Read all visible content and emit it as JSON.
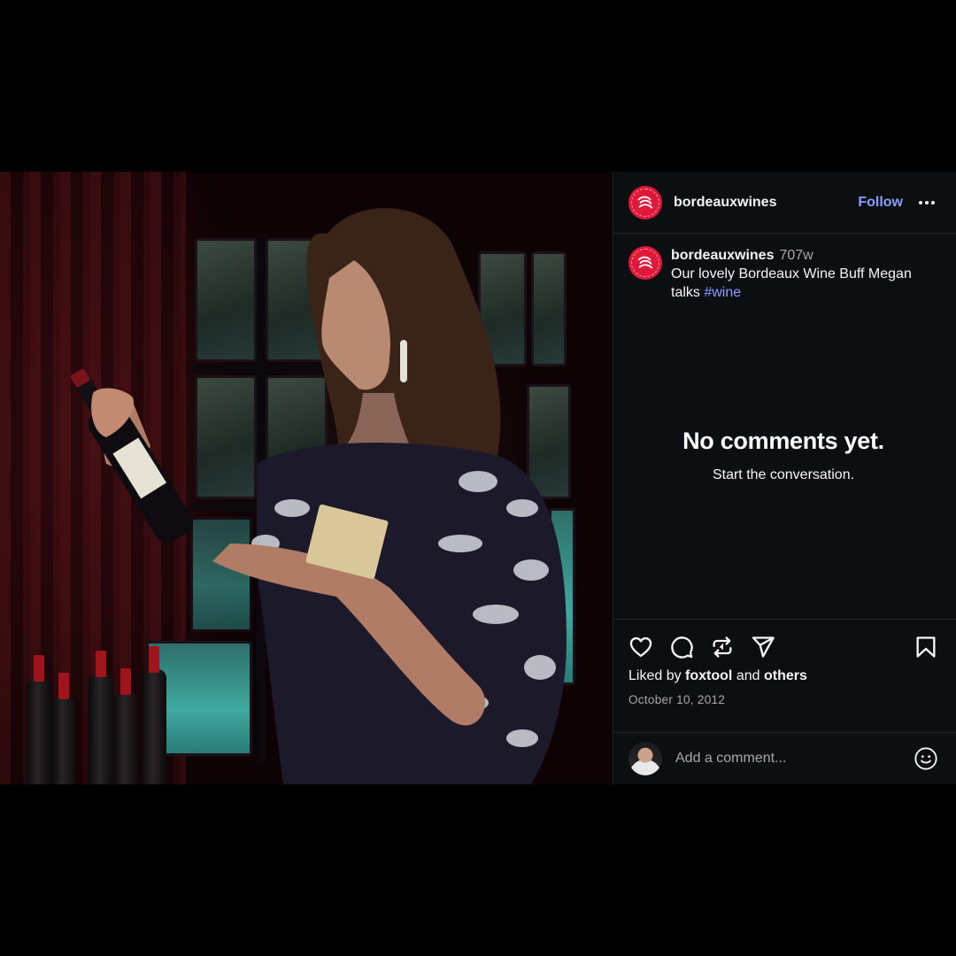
{
  "post": {
    "account": {
      "username": "bordeauxwines",
      "follow_label": "Follow",
      "avatar_icon": "bordeaux-logo-icon",
      "brand_color": "#e0193a"
    },
    "caption": {
      "username": "bordeauxwines",
      "age": "707w",
      "text": "Our lovely Bordeaux Wine Buff Megan talks ",
      "hashtag": "#wine"
    },
    "comments": {
      "empty_title": "No comments yet.",
      "empty_subtitle": "Start the conversation."
    },
    "actions": {
      "icons": [
        "heart-icon",
        "comment-icon",
        "repost-icon",
        "share-icon",
        "bookmark-icon"
      ]
    },
    "likes": {
      "prefix": "Liked by ",
      "user": "foxtool",
      "middle": " and ",
      "others": "others"
    },
    "date": "October 10, 2012",
    "comment_box": {
      "placeholder": "Add a comment...",
      "emoji_icon": "smiley-icon"
    },
    "colors": {
      "accent_link": "#8c9eff",
      "panel_bg": "#0c0f12",
      "muted_text": "#a8a8a8"
    }
  }
}
